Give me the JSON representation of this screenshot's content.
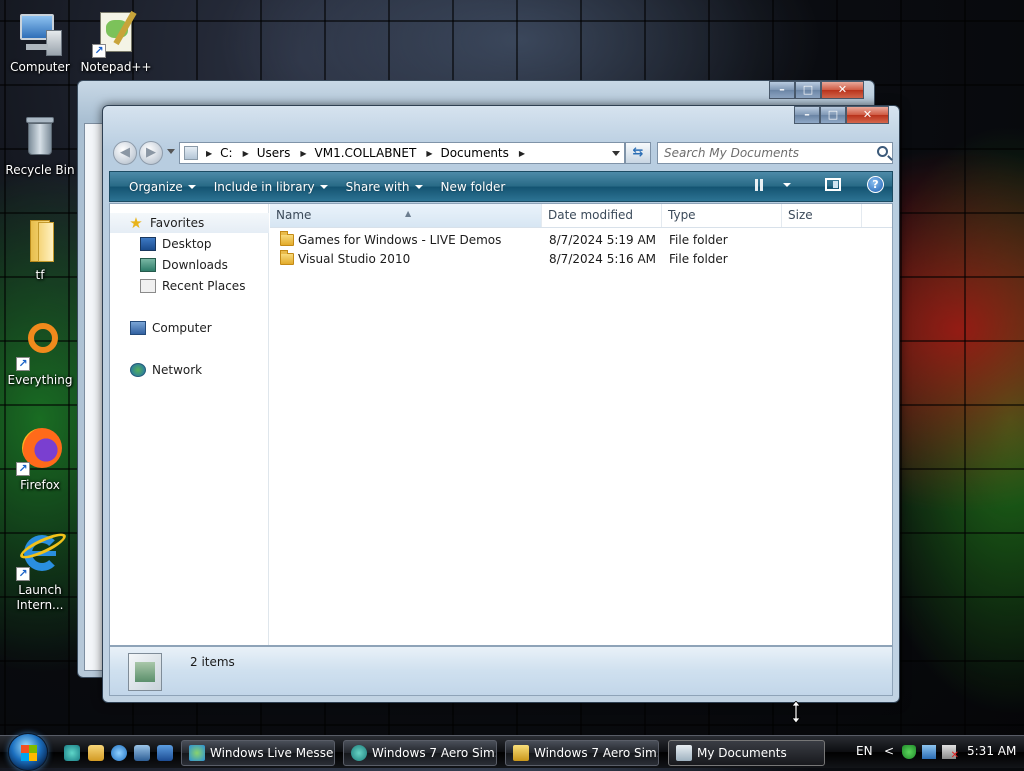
{
  "desktop": {
    "icons": [
      {
        "label": "Computer",
        "icon": "computer-icon"
      },
      {
        "label": "Notepad++",
        "icon": "notepad-plus-plus-icon"
      },
      {
        "label": "Recycle Bin",
        "icon": "recycle-bin-icon"
      },
      {
        "label": "tf",
        "icon": "folder-icon"
      },
      {
        "label": "Everything",
        "icon": "everything-icon"
      },
      {
        "label": "Firefox",
        "icon": "firefox-icon"
      },
      {
        "label": "Launch Intern...",
        "icon": "internet-explorer-icon"
      }
    ]
  },
  "explorer": {
    "caption_buttons": {
      "minimize": "–",
      "maximize": "□",
      "close": "✕"
    },
    "nav": {
      "back": "◀",
      "forward": "▶"
    },
    "breadcrumb": [
      "C:",
      "Users",
      "VM1.COLLABNET",
      "Documents"
    ],
    "search_placeholder": "Search My Documents",
    "toolbar": {
      "organize": "Organize",
      "include_in_library": "Include in library",
      "share_with": "Share with",
      "new_folder": "New folder",
      "help": "?"
    },
    "navpane": {
      "favorites": "Favorites",
      "desktop": "Desktop",
      "downloads": "Downloads",
      "recent_places": "Recent Places",
      "computer": "Computer",
      "network": "Network"
    },
    "columns": {
      "name": "Name",
      "date_modified": "Date modified",
      "type": "Type",
      "size": "Size"
    },
    "files": [
      {
        "name": "Games for Windows - LIVE Demos",
        "date": "8/7/2024 5:19 AM",
        "type": "File folder",
        "size": ""
      },
      {
        "name": "Visual Studio 2010",
        "date": "8/7/2024 5:16 AM",
        "type": "File folder",
        "size": ""
      }
    ],
    "details": {
      "item_count": "2 items"
    }
  },
  "taskbar": {
    "tasks": [
      {
        "label": "Windows Live Messe...",
        "icon": "messenger-icon"
      },
      {
        "label": "Windows 7 Aero Sim...",
        "icon": "aero-icon"
      },
      {
        "label": "Windows 7 Aero Sim...",
        "icon": "archive-icon"
      },
      {
        "label": "My Documents",
        "icon": "documents-icon"
      }
    ],
    "language": "EN",
    "tray_chevron": "<",
    "clock": "5:31 AM"
  },
  "colors": {
    "toolbar": "#135371",
    "taskbar": "#0c0d10",
    "close_button": "#b8321b"
  }
}
